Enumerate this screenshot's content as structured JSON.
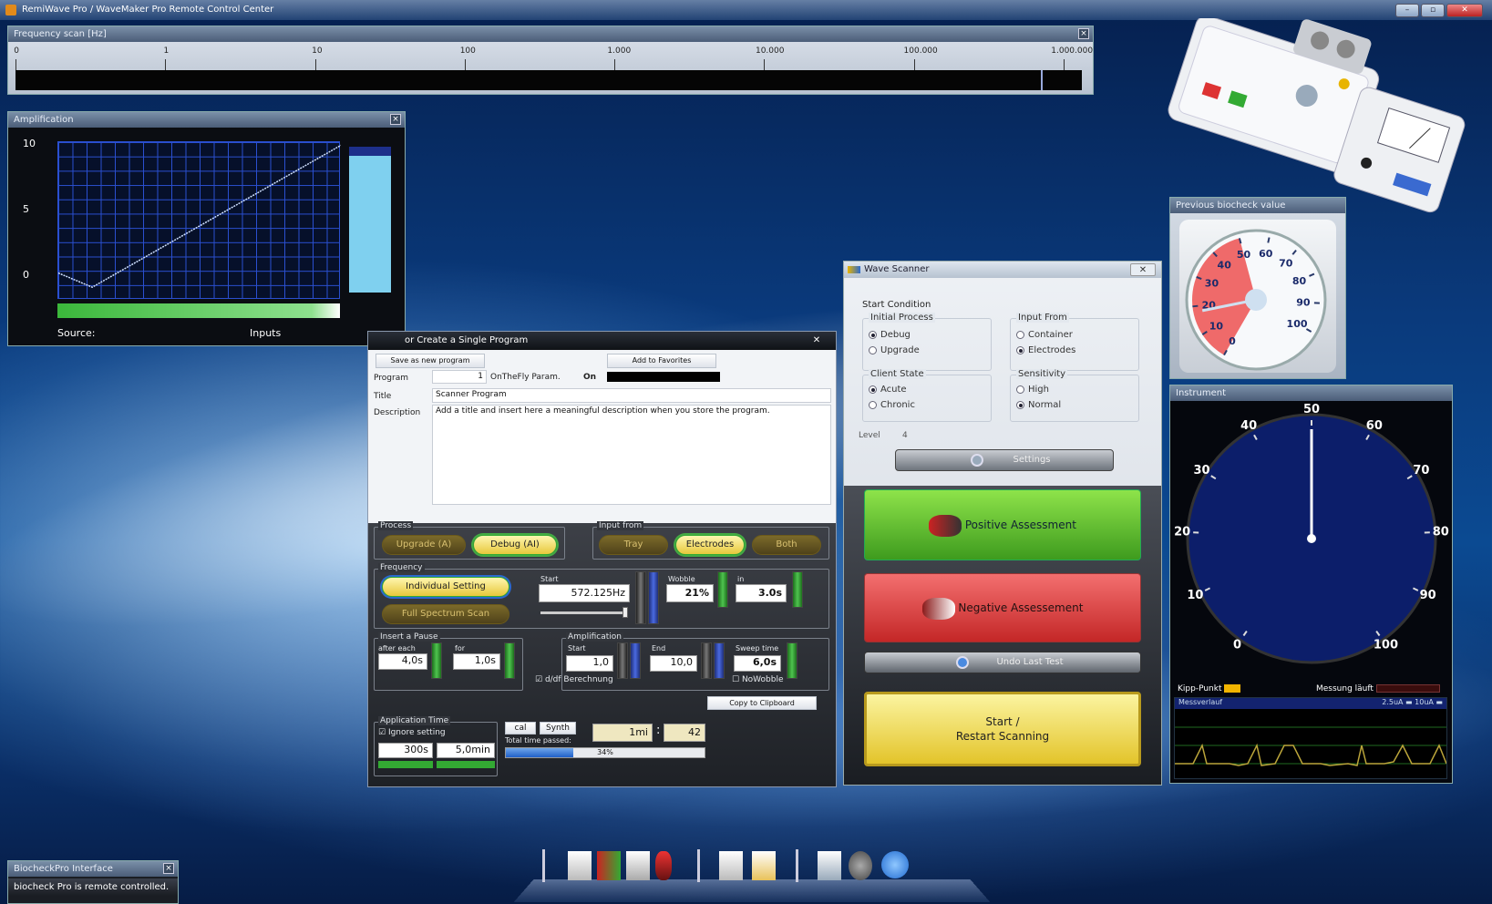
{
  "app": {
    "title": "RemiWave Pro / WaveMaker Pro Remote Control Center"
  },
  "freq_scan": {
    "title": "Frequency scan [Hz]",
    "ticks": [
      "0",
      "1",
      "10",
      "100",
      "1.000",
      "10.000",
      "100.000",
      "1.000.000"
    ]
  },
  "amplification": {
    "title": "Amplification",
    "y_labels": [
      "10",
      "5",
      "0"
    ],
    "source_label": "Source:",
    "inputs_label": "Inputs",
    "chart_data": {
      "type": "line",
      "x": [
        0,
        0.12,
        1.0
      ],
      "y": [
        1.7,
        0.8,
        9.8
      ],
      "ylim": [
        0,
        10
      ]
    }
  },
  "prev_biocheck": {
    "title": "Previous biocheck value",
    "ticks": [
      "0",
      "10",
      "20",
      "30",
      "40",
      "50",
      "60",
      "70",
      "80",
      "90",
      "100"
    ]
  },
  "instrument": {
    "title": "Instrument",
    "ticks": [
      "0",
      "10",
      "20",
      "30",
      "40",
      "50",
      "60",
      "70",
      "80",
      "90",
      "100"
    ],
    "kipp_label": "Kipp-Punkt",
    "messung_label": "Messung läuft",
    "verlauf_label": "Messverlauf",
    "range1": "2.5uA",
    "range2": "10uA"
  },
  "wave_scanner": {
    "title": "Wave Scanner",
    "start_condition": "Start Condition",
    "initial_process": "Initial Process",
    "debug": "Debug",
    "upgrade": "Upgrade",
    "input_from": "Input From",
    "container": "Container",
    "electrodes": "Electrodes",
    "client_state": "Client State",
    "acute": "Acute",
    "chronic": "Chronic",
    "sensitivity": "Sensitivity",
    "high": "High",
    "normal": "Normal",
    "level_label": "Level",
    "level_value": "4",
    "settings": "Settings",
    "positive": "Positive Assessment",
    "negative": "Negative Assessement",
    "undo": "Undo Last Test",
    "start_line1": "Start /",
    "start_line2": "Restart Scanning"
  },
  "program": {
    "title": "or Create a Single Program",
    "save_new": "Save as new program",
    "add_fav": "Add to Favorites",
    "program_label": "Program",
    "program_value": "1",
    "onthefly": "OnTheFly Param.",
    "on_label": "On",
    "title_label": "Title",
    "title_value": "Scanner Program",
    "desc_label": "Description",
    "desc_value": "Add a title and insert here a meaningful description when you store the program.",
    "process_label": "Process",
    "upgrade_ai": "Upgrade (A)",
    "debug_ai": "Debug (AI)",
    "input_from_label": "Input from",
    "tray": "Tray",
    "electrodes": "Electrodes",
    "both": "Both",
    "frequency_label": "Frequency",
    "individual": "Individual Setting",
    "full_scan": "Full Spectrum Scan",
    "start_label": "Start",
    "start_value": "572.125Hz",
    "wobble_label": "Wobble",
    "wobble_value": "21%",
    "in_label": "in",
    "in_value": "3.0s",
    "pause_label": "Insert a Pause",
    "after_each": "after each",
    "after_value": "4,0s",
    "for_label": "for",
    "for_value": "1,0s",
    "amplif_label": "Amplification",
    "amp_start_label": "Start",
    "amp_start": "1,0",
    "amp_end_label": "End",
    "amp_end": "10,0",
    "sweep_label": "Sweep time",
    "sweep_value": "6,0s",
    "nowobble": "NoWobble",
    "ddf": "d/df Berechnung",
    "copy": "Copy to Clipboard",
    "app_time": "Application Time",
    "ignore": "Ignore setting",
    "t1": "300s",
    "t2": "5,0min",
    "cal": "cal",
    "synth": "Synth",
    "total_time": "Total time passed:",
    "min_value": "1mi",
    "sec_value": "42",
    "progress_label": "34%",
    "progress": 0.34
  },
  "biocheck": {
    "title": "BiocheckPro Interface",
    "status": "biocheck Pro is remote controlled."
  }
}
